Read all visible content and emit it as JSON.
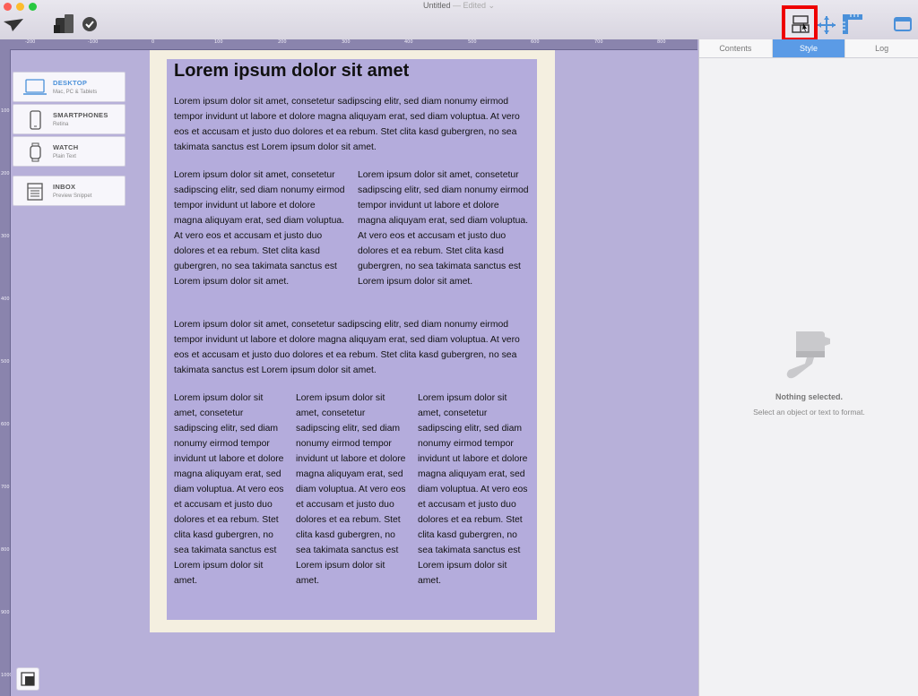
{
  "window": {
    "title": "Untitled",
    "edited": "— Edited ⌄"
  },
  "toolbar": {
    "icons": [
      "send-icon",
      "devices-icon",
      "check-icon",
      "layout-icon",
      "move-icon",
      "ruler-icon",
      "window-icon"
    ]
  },
  "rulers": {
    "top_labels": [
      "-200",
      "-100",
      "0",
      "100",
      "200",
      "300",
      "400",
      "500",
      "600",
      "700",
      "800"
    ],
    "left_labels": [
      "100",
      "200",
      "300",
      "400",
      "500",
      "600",
      "700",
      "800",
      "900",
      "1000"
    ]
  },
  "devices": [
    {
      "name": "DESKTOP",
      "sub": "Mac, PC & Tablets",
      "active": true
    },
    {
      "name": "SMARTPHONES",
      "sub": "Retina",
      "active": false
    },
    {
      "name": "WATCH",
      "sub": "Plain Text",
      "active": false
    },
    {
      "name": "INBOX",
      "sub": "Preview Snippet",
      "active": false
    }
  ],
  "document": {
    "heading": "Lorem ipsum dolor sit amet",
    "p1": "Lorem ipsum dolor sit amet, consetetur sadipscing elitr, sed diam nonumy eirmod tempor invidunt ut labore et dolore magna aliquyam erat, sed diam voluptua. At vero eos et accusam et justo duo dolores et ea rebum. Stet clita kasd gubergren, no sea takimata sanctus est Lorem ipsum dolor sit amet.",
    "col2a": "Lorem ipsum dolor sit amet, consetetur sadipscing elitr, sed diam nonumy eirmod tempor invidunt ut labore et dolore magna aliquyam erat, sed diam voluptua. At vero eos et accusam et justo duo dolores et ea rebum. Stet clita kasd gubergren, no sea takimata sanctus est Lorem ipsum dolor sit amet.",
    "col2b": "Lorem ipsum dolor sit amet, consetetur sadipscing elitr, sed diam nonumy eirmod tempor invidunt ut labore et dolore magna aliquyam erat, sed diam voluptua. At vero eos et accusam et justo duo dolores et ea rebum. Stet clita kasd gubergren, no sea takimata sanctus est Lorem ipsum dolor sit amet.",
    "p2": "Lorem ipsum dolor sit amet, consetetur sadipscing elitr, sed diam nonumy eirmod tempor invidunt ut labore et dolore magna aliquyam erat, sed diam voluptua. At vero eos et accusam et justo duo dolores et ea rebum. Stet clita kasd gubergren, no sea takimata sanctus est Lorem ipsum dolor sit amet.",
    "col3a": "Lorem ipsum dolor sit amet, consetetur sadipscing elitr, sed diam nonumy eirmod tempor invidunt ut labore et dolore magna aliquyam erat, sed diam voluptua. At vero eos et accusam et justo duo dolores et ea rebum. Stet clita kasd gubergren, no sea takimata sanctus est Lorem ipsum dolor sit amet.",
    "col3b": "Lorem ipsum dolor sit amet, consetetur sadipscing elitr, sed diam nonumy eirmod tempor invidunt ut labore et dolore magna aliquyam erat, sed diam voluptua. At vero eos et accusam et justo duo dolores et ea rebum. Stet clita kasd gubergren, no sea takimata sanctus est Lorem ipsum dolor sit amet.",
    "col3c": "Lorem ipsum dolor sit amet, consetetur sadipscing elitr, sed diam nonumy eirmod tempor invidunt ut labore et dolore magna aliquyam erat, sed diam voluptua. At vero eos et accusam et justo duo dolores et ea rebum. Stet clita kasd gubergren, no sea takimata sanctus est Lorem ipsum dolor sit amet."
  },
  "sidebar": {
    "tabs": [
      "Contents",
      "Style",
      "Log"
    ],
    "active_tab": "Style",
    "empty_title": "Nothing selected.",
    "empty_sub": "Select an object or text to format."
  },
  "colors": {
    "accent": "#5b9be6",
    "canvas": "#b7b0d9",
    "content": "#b4acdc",
    "highlight": "#ee0000"
  }
}
